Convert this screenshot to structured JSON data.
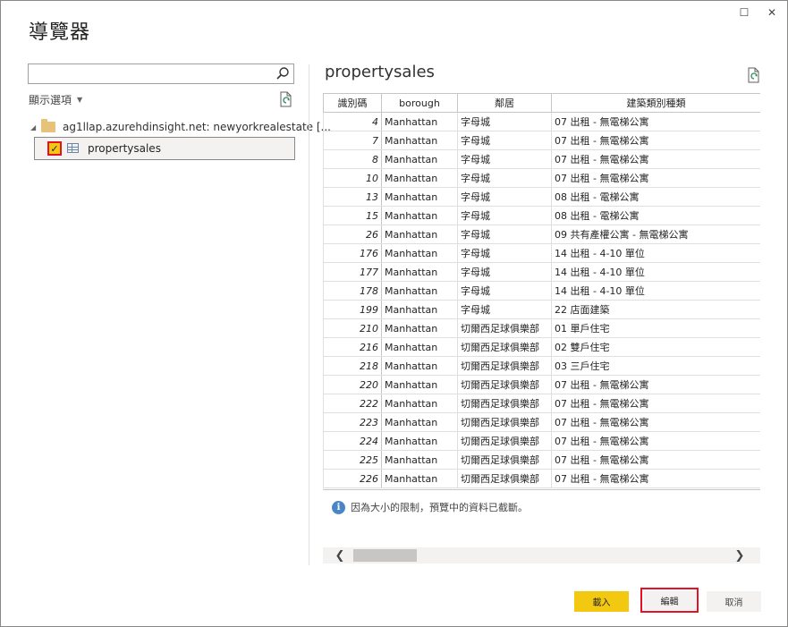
{
  "window": {
    "title": "導覽器",
    "maximize_glyph": "☐",
    "close_glyph": "✕"
  },
  "left_panel": {
    "search": {
      "value": "",
      "placeholder": ""
    },
    "display_options_label": "顯示選項",
    "tree": {
      "source_label": "ag1llap.azurehdinsight.net: newyorkrealestate [...",
      "table_label": "propertysales",
      "table_checked": true
    }
  },
  "preview": {
    "title": "propertysales",
    "columns": [
      "識別碼",
      "borough",
      "鄰居",
      "建築類別種類"
    ],
    "rows": [
      [
        "4",
        "Manhattan",
        "字母城",
        "07 出租 - 無電梯公寓"
      ],
      [
        "7",
        "Manhattan",
        "字母城",
        "07 出租 - 無電梯公寓"
      ],
      [
        "8",
        "Manhattan",
        "字母城",
        "07 出租 - 無電梯公寓"
      ],
      [
        "10",
        "Manhattan",
        "字母城",
        "07 出租 - 無電梯公寓"
      ],
      [
        "13",
        "Manhattan",
        "字母城",
        "08 出租 - 電梯公寓"
      ],
      [
        "15",
        "Manhattan",
        "字母城",
        "08 出租 - 電梯公寓"
      ],
      [
        "26",
        "Manhattan",
        "字母城",
        "09 共有產權公寓 - 無電梯公寓"
      ],
      [
        "176",
        "Manhattan",
        "字母城",
        "14 出租 - 4-10 單位"
      ],
      [
        "177",
        "Manhattan",
        "字母城",
        "14 出租 - 4-10 單位"
      ],
      [
        "178",
        "Manhattan",
        "字母城",
        "14 出租 - 4-10 單位"
      ],
      [
        "199",
        "Manhattan",
        "字母城",
        "22 店面建築"
      ],
      [
        "210",
        "Manhattan",
        "切爾西足球俱樂部",
        "01 單戶住宅"
      ],
      [
        "216",
        "Manhattan",
        "切爾西足球俱樂部",
        "02 雙戶住宅"
      ],
      [
        "218",
        "Manhattan",
        "切爾西足球俱樂部",
        "03 三戶住宅"
      ],
      [
        "220",
        "Manhattan",
        "切爾西足球俱樂部",
        "07 出租 - 無電梯公寓"
      ],
      [
        "222",
        "Manhattan",
        "切爾西足球俱樂部",
        "07 出租 - 無電梯公寓"
      ],
      [
        "223",
        "Manhattan",
        "切爾西足球俱樂部",
        "07 出租 - 無電梯公寓"
      ],
      [
        "224",
        "Manhattan",
        "切爾西足球俱樂部",
        "07 出租 - 無電梯公寓"
      ],
      [
        "225",
        "Manhattan",
        "切爾西足球俱樂部",
        "07 出租 - 無電梯公寓"
      ],
      [
        "226",
        "Manhattan",
        "切爾西足球俱樂部",
        "07 出租 - 無電梯公寓"
      ]
    ],
    "truncation_note": "因為大小的限制，預覽中的資料已截斷。"
  },
  "footer": {
    "load_label": "載入",
    "edit_label": "編輯",
    "cancel_label": "取消"
  },
  "colors": {
    "accent": "#f2c811",
    "highlight": "#e81123",
    "info": "#4a86c5"
  },
  "icons": [
    "search-icon",
    "refresh-doc-icon",
    "folder-icon",
    "table-icon",
    "info-icon",
    "chevron-left-icon",
    "chevron-right-icon"
  ]
}
